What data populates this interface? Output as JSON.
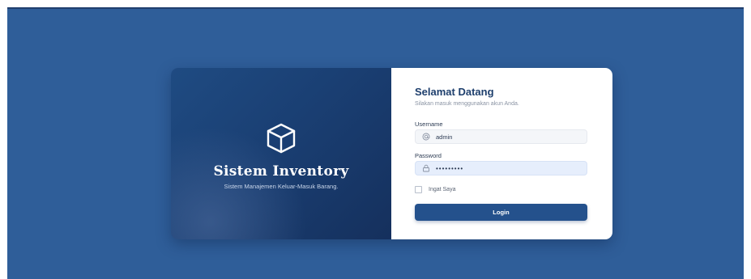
{
  "brand": {
    "icon": "cube-icon",
    "title": "Sistem Inventory",
    "subtitle": "Sistem Manajemen Keluar-Masuk Barang."
  },
  "form": {
    "title": "Selamat Datang",
    "subtitle": "Silakan masuk menggunakan akun Anda.",
    "username": {
      "label": "Username",
      "icon": "at-sign-icon",
      "value": "admin"
    },
    "password": {
      "label": "Password",
      "icon": "lock-icon",
      "value": "•••••••••"
    },
    "remember": {
      "label": "Ingat Saya",
      "checked": false
    },
    "submit_label": "Login"
  },
  "colors": {
    "background": "#2f5e99",
    "brand_panel": "#1a3f73",
    "accent": "#24518c",
    "title_text": "#1e3f6d"
  }
}
